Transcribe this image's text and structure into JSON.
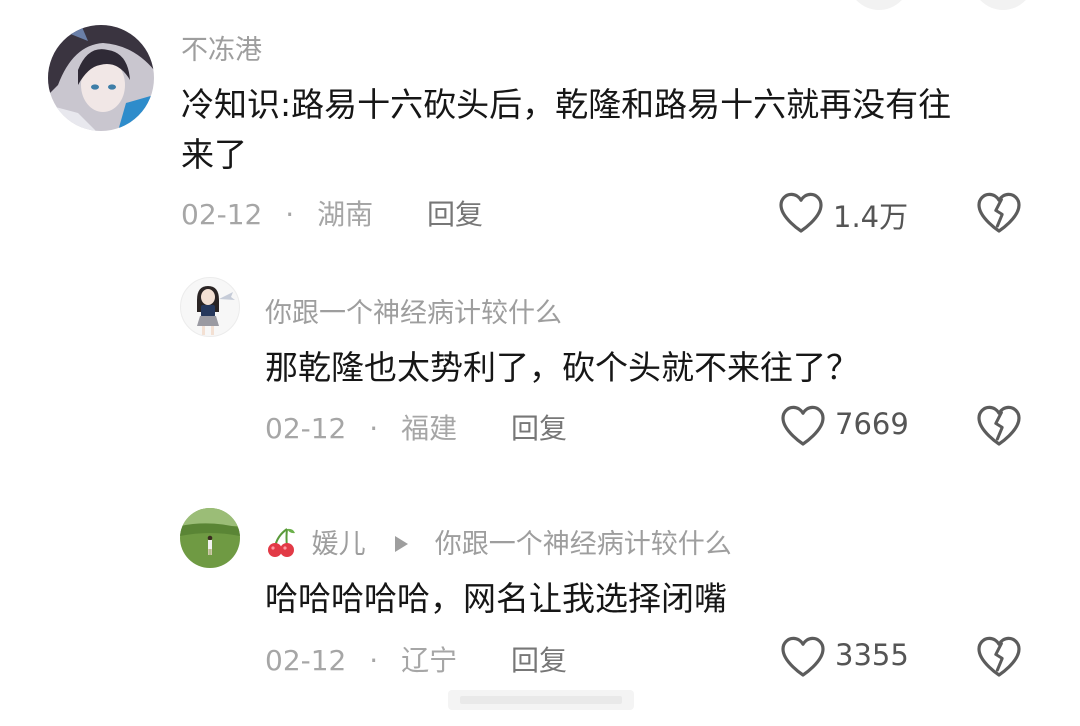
{
  "comments": [
    {
      "username": "不冻港",
      "text_line1": "冷知识:路易十六砍头后，乾隆和路易十六就再没有往",
      "text_line2": "来了",
      "date": "02-12",
      "location": "湖南",
      "reply_label": "回复",
      "likes": "1.4万"
    },
    {
      "username": "你跟一个神经病计较什么",
      "text": "那乾隆也太势利了，砍个头就不来往了？",
      "date": "02-12",
      "location": "福建",
      "reply_label": "回复",
      "likes": "7669"
    },
    {
      "username": "媛儿",
      "reply_to": "你跟一个神经病计较什么",
      "text": "哈哈哈哈哈，网名让我选择闭嘴",
      "date": "02-12",
      "location": "辽宁",
      "reply_label": "回复",
      "likes": "3355"
    }
  ],
  "separator": "·",
  "colors": {
    "username": "#9e9e9e",
    "text": "#161616",
    "meta": "#a6a6a6",
    "icon": "#5c5c5c"
  },
  "icons": [
    "heart-icon",
    "dislike-icon",
    "cherry-icon",
    "reply-arrow-icon"
  ]
}
